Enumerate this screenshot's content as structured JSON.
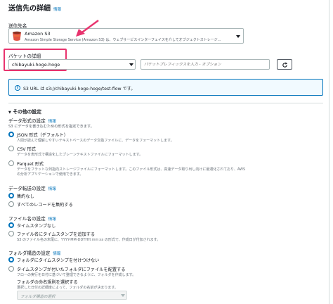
{
  "section": {
    "title": "送信先の詳細",
    "info": "情報"
  },
  "destination": {
    "label": "送信先名",
    "service_name": "Amazon S3",
    "service_desc": "Amazon Simple Storage Service (Amazon S3) は、ウェブサービスインターフェイスを介してオブジェクトストレージ..."
  },
  "bucket": {
    "label": "バケットの詳細",
    "value": "chibayuki-hoge-hoge",
    "prefix_placeholder": "バケットプレフィックスを入力 - オプション",
    "s3_url_text": "S3 URL は s3://chibayuki-hoge-hoge/test-flow です。"
  },
  "other_settings": {
    "title": "その他の設定",
    "format": {
      "label": "データ形式の設定",
      "info": "情報",
      "desc": "S3 にデータを書き込むための形式を指定できます。",
      "options": [
        {
          "title": "JSON 形式（デフォルト）",
          "desc": "人間が読んで理解しやすいテキストベースのデータ交換ファイルに、データをフォーマットします。",
          "selected": true
        },
        {
          "title": "CSV 形式",
          "desc": "データを表形式で構造化したプレーンテキストファイルにフォーマットします。",
          "selected": false
        },
        {
          "title": "Parquet 形式",
          "desc1": "データをフラットな列指向ストレージファイルにフォーマットします。このファイル形式は、高速データ取り出し向けに最適化されており、AWS",
          "desc2": "の分析アプリケーションで使用できます。",
          "selected": false
        }
      ]
    },
    "transfer": {
      "label": "データ転送の設定",
      "info": "情報",
      "options": [
        {
          "title": "集約なし",
          "selected": true
        },
        {
          "title": "すべてのレコードを集約する",
          "selected": false
        }
      ]
    },
    "filename": {
      "label": "ファイル名の設定",
      "info": "情報",
      "options": [
        {
          "title": "タイムスタンプなし",
          "selected": true
        },
        {
          "title": "ファイル名にタイムスタンプを追加する",
          "desc": "S3 のファイル名の末尾に、YYYY-MM-DDTHH:mm:ss の形式で、作成日が付加されます。",
          "selected": false
        }
      ]
    },
    "folder": {
      "label": "フォルダ構造の設定",
      "info": "情報",
      "options": [
        {
          "title": "フォルダにタイムスタンプを付けつけない",
          "selected": true
        },
        {
          "title": "タイムスタンプが付いたフォルダにファイルを配置する",
          "desc": "フローの実行を日付に基づいて整理できるように、フォルダを作成します。",
          "selected": false
        }
      ],
      "naming_label": "フォルダの命名規則を選択する",
      "naming_desc": "選択した日付の詳細度によって、フォルダの名前が決まります。",
      "naming_placeholder": "フォルダ構造の選択"
    }
  },
  "colors": {
    "annotation": "#e8336e",
    "link": "#0073bb",
    "selected": "#0073bb",
    "s3_icon": "#e25444"
  }
}
